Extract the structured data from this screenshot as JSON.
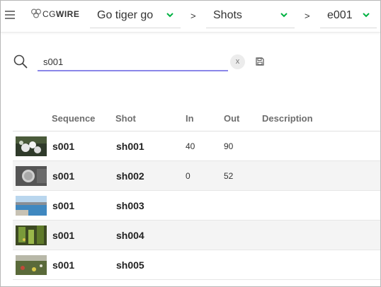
{
  "topbar": {
    "logo_cg": "CG",
    "logo_wire": "WIRE",
    "production": "Go tiger go",
    "section": "Shots",
    "episode": "e001",
    "separator": ">"
  },
  "search": {
    "value": "s001",
    "clear_label": "x"
  },
  "table": {
    "headers": {
      "sequence": "Sequence",
      "shot": "Shot",
      "in": "In",
      "out": "Out",
      "description": "Description"
    },
    "rows": [
      {
        "sequence": "s001",
        "shot": "sh001",
        "in": "40",
        "out": "90"
      },
      {
        "sequence": "s001",
        "shot": "sh002",
        "in": "0",
        "out": "52"
      },
      {
        "sequence": "s001",
        "shot": "sh003",
        "in": "",
        "out": ""
      },
      {
        "sequence": "s001",
        "shot": "sh004",
        "in": "",
        "out": ""
      },
      {
        "sequence": "s001",
        "shot": "sh005",
        "in": "",
        "out": ""
      }
    ]
  },
  "colors": {
    "accent": "#8a86e8",
    "chevron": "#00b242"
  }
}
